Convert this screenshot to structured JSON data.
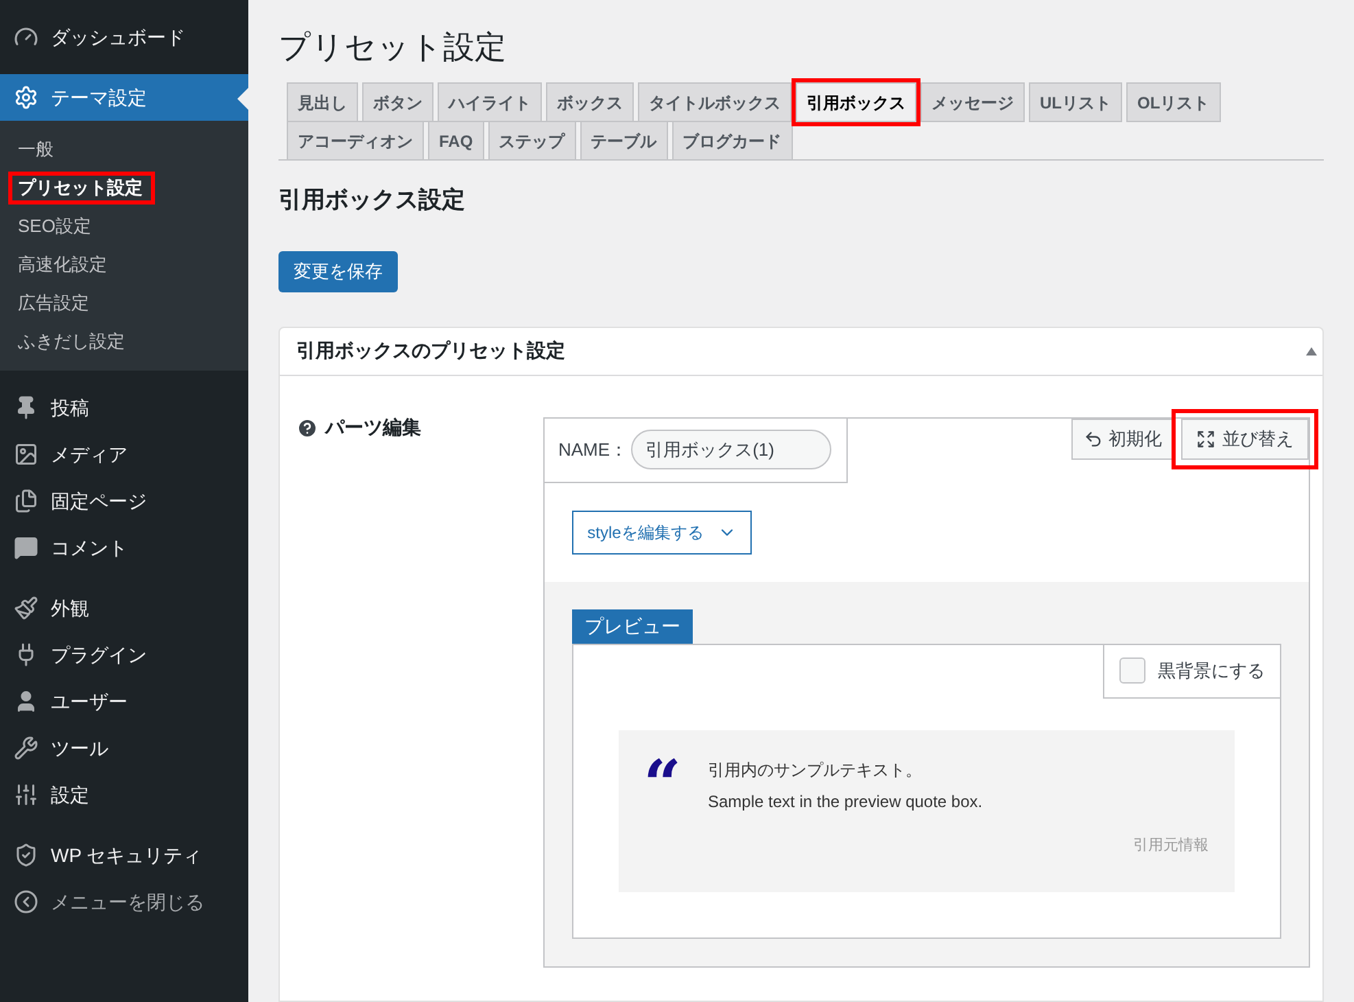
{
  "sidebar": {
    "groups": [
      [
        {
          "label": "ダッシュボード",
          "kind": "gauge",
          "current": false
        }
      ],
      [
        {
          "label": "テーマ設定",
          "kind": "gear",
          "current": true,
          "submenu": [
            {
              "label": "一般",
              "selected": false,
              "highlighted": false
            },
            {
              "label": "プリセット設定",
              "selected": true,
              "highlighted": true
            },
            {
              "label": "SEO設定",
              "selected": false,
              "highlighted": false
            },
            {
              "label": "高速化設定",
              "selected": false,
              "highlighted": false
            },
            {
              "label": "広告設定",
              "selected": false,
              "highlighted": false
            },
            {
              "label": "ふきだし設定",
              "selected": false,
              "highlighted": false
            }
          ]
        }
      ],
      [
        {
          "label": "投稿",
          "kind": "pin",
          "current": false
        },
        {
          "label": "メディア",
          "kind": "media",
          "current": false
        },
        {
          "label": "固定ページ",
          "kind": "pages",
          "current": false
        },
        {
          "label": "コメント",
          "kind": "comment",
          "current": false
        }
      ],
      [
        {
          "label": "外観",
          "kind": "brush",
          "current": false
        },
        {
          "label": "プラグイン",
          "kind": "plug",
          "current": false
        },
        {
          "label": "ユーザー",
          "kind": "user",
          "current": false
        },
        {
          "label": "ツール",
          "kind": "wrench",
          "current": false
        },
        {
          "label": "設定",
          "kind": "sliders",
          "current": false
        }
      ],
      [
        {
          "label": "WP セキュリティ",
          "kind": "shield",
          "current": false
        },
        {
          "label": "メニューを閉じる",
          "kind": "collapse",
          "current": false
        }
      ]
    ]
  },
  "page": {
    "title": "プリセット設定",
    "tabs": [
      {
        "label": "見出し",
        "selected": false,
        "highlighted": false
      },
      {
        "label": "ボタン",
        "selected": false,
        "highlighted": false
      },
      {
        "label": "ハイライト",
        "selected": false,
        "highlighted": false
      },
      {
        "label": "ボックス",
        "selected": false,
        "highlighted": false
      },
      {
        "label": "タイトルボックス",
        "selected": false,
        "highlighted": false
      },
      {
        "label": "引用ボックス",
        "selected": true,
        "highlighted": true
      },
      {
        "label": "メッセージ",
        "selected": false,
        "highlighted": false
      },
      {
        "label": "ULリスト",
        "selected": false,
        "highlighted": false
      },
      {
        "label": "OLリスト",
        "selected": false,
        "highlighted": false
      },
      {
        "label": "アコーディオン",
        "selected": false,
        "highlighted": false
      },
      {
        "label": "FAQ",
        "selected": false,
        "highlighted": false
      },
      {
        "label": "ステップ",
        "selected": false,
        "highlighted": false
      },
      {
        "label": "テーブル",
        "selected": false,
        "highlighted": false
      },
      {
        "label": "ブログカード",
        "selected": false,
        "highlighted": false
      }
    ],
    "section_heading": "引用ボックス設定",
    "save_button": "変更を保存",
    "panel": {
      "title": "引用ボックスのプリセット設定",
      "expanded": true,
      "field_label": "パーツ編集",
      "name_label": "NAME：",
      "name_value": "引用ボックス(1)",
      "reset_button": {
        "label": "初期化",
        "highlighted": false
      },
      "sort_button": {
        "label": "並び替え",
        "highlighted": true
      },
      "style_button": "styleを編集する",
      "preview_label": "プレビュー",
      "dark_bg": {
        "label": "黒背景にする",
        "checked": false
      },
      "quote": {
        "mark": "“",
        "lines": [
          "引用内のサンプルテキスト。",
          "Sample text in the preview quote box."
        ],
        "cite": "引用元情報"
      }
    }
  }
}
